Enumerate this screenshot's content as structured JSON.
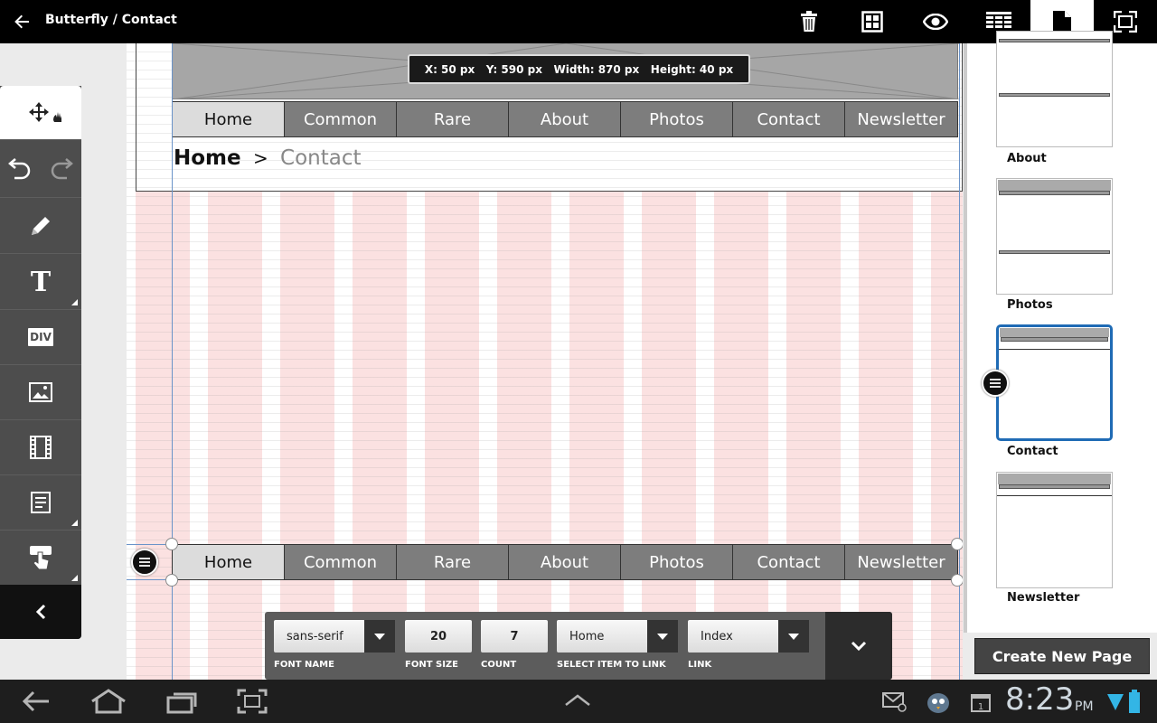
{
  "topbar": {
    "title": "Butterfly / Contact",
    "actions": [
      "trash-icon",
      "grid-layout-icon",
      "preview-eye-icon",
      "table-icon",
      "page-icon",
      "fullscreen-icon"
    ],
    "active_action": "page-icon"
  },
  "toolbar": {
    "tools": [
      "move-icon",
      "undo-icon",
      "redo-icon",
      "pencil-icon",
      "text-icon",
      "div-icon",
      "image-icon",
      "video-icon",
      "form-icon",
      "touch-icon",
      "collapse-icon"
    ],
    "div_label": "DIV",
    "text_label": "T"
  },
  "canvas": {
    "tooltip": "X: 50 px   Y: 590 px   Width: 870 px   Height: 40 px",
    "top_nav": [
      "Home",
      "Common",
      "Rare",
      "About",
      "Photos",
      "Contact",
      "Newsletter"
    ],
    "bottom_nav": [
      "Home",
      "Common",
      "Rare",
      "About",
      "Photos",
      "Contact",
      "Newsletter"
    ],
    "breadcrumb": {
      "home": "Home",
      "separator": ">",
      "current": "Contact"
    },
    "colors": {
      "grid_column": "#fbe1e1",
      "guide": "#6a93c9",
      "nav_bg": "#7d7d7d",
      "nav_selected": "#dcdcdc"
    }
  },
  "properties": {
    "font_name": {
      "value": "sans-serif",
      "label": "FONT NAME"
    },
    "font_size": {
      "value": "20",
      "label": "FONT SIZE"
    },
    "count": {
      "value": "7",
      "label": "COUNT"
    },
    "select_item": {
      "value": "Home",
      "label": "SELECT ITEM TO LINK"
    },
    "link": {
      "value": "Index",
      "label": "LINK"
    }
  },
  "pages": [
    {
      "label": "About",
      "selected": false
    },
    {
      "label": "Photos",
      "selected": false
    },
    {
      "label": "Contact",
      "selected": true
    },
    {
      "label": "Newsletter",
      "selected": false
    }
  ],
  "create_button": "Create New Page",
  "statusbar": {
    "time": "8:23",
    "ampm": "PM"
  }
}
